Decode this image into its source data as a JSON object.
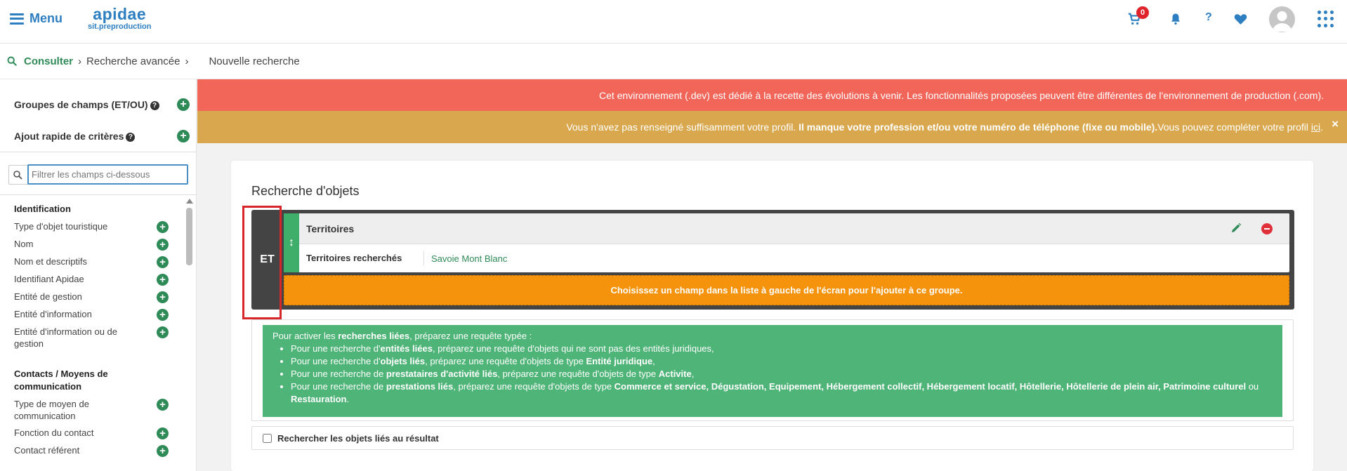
{
  "topbar": {
    "menu_label": "Menu",
    "logo_main": "apidae",
    "logo_sub": "sit.preproduction",
    "cart_count": "0",
    "help_label": "?",
    "brand_color": "#2d7fc1"
  },
  "breadcrumb": {
    "consult": "Consulter",
    "advanced": "Recherche avancée",
    "current": "Nouvelle recherche"
  },
  "sidebar": {
    "groups_label": "Groupes de champs (ET/OU)",
    "quick_add_label": "Ajout rapide de critères",
    "filter_placeholder": "Filtrer les champs ci-dessous",
    "sections": [
      {
        "title": "Identification",
        "fields": [
          "Type d'objet touristique",
          "Nom",
          "Nom et descriptifs",
          "Identifiant Apidae",
          "Entité de gestion",
          "Entité d'information",
          "Entité d'information ou de gestion"
        ]
      },
      {
        "title": "Contacts / Moyens de communication",
        "fields": [
          "Type de moyen de communication",
          "Fonction du contact",
          "Contact référent"
        ]
      }
    ]
  },
  "banners": {
    "dev_text": "Cet environnement (.dev) est dédié à la recette des évolutions à venir. Les fonctionnalités proposées peuvent être différentes de l'environnement de production (.com).",
    "profile_text_1": "Vous n'avez pas renseigné suffisamment votre profil. ",
    "profile_text_bold": "Il manque votre profession et/ou votre numéro de téléphone (fixe ou mobile).",
    "profile_text_2": "Vous pouvez compléter votre profil ",
    "profile_link": "ici",
    "profile_text_3": ".",
    "close_label": "×"
  },
  "search": {
    "title": "Recherche d'objets",
    "operator": "ET",
    "criterion": {
      "title": "Territoires",
      "key": "Territoires recherchés",
      "value": "Savoie Mont Blanc"
    },
    "add_hint": "Choisissez un champ dans la liste à gauche de l'écran pour l'ajouter à ce groupe.",
    "info": {
      "intro_1": "Pour activer les ",
      "intro_bold": "recherches liées",
      "intro_2": ", préparez une requête typée :",
      "items": [
        {
          "pre": "Pour une recherche d'",
          "bold": "entités liées",
          "post": ", préparez une requête d'objets qui ne sont pas des entités juridiques,"
        },
        {
          "pre": "Pour une recherche d'",
          "bold": "objets liés",
          "post": ", préparez une requête d'objets de type ",
          "bold2": "Entité juridique",
          "post2": ","
        },
        {
          "pre": "Pour une recherche de ",
          "bold": "prestataires d'activité liés",
          "post": ", préparez une requête d'objets de type ",
          "bold2": "Activite",
          "post2": ","
        },
        {
          "pre": "Pour une recherche de ",
          "bold": "prestations liés",
          "post": ", préparez une requête d'objets de type ",
          "bold2": "Commerce et service, Dégustation, Equipement, Hébergement collectif, Hébergement locatif, Hôtellerie, Hôtellerie de plein air, Patrimoine culturel",
          "post2": " ou ",
          "bold3": "Restauration",
          "post3": "."
        }
      ]
    },
    "linked_checkbox_label": "Rechercher les objets liés au résultat"
  }
}
